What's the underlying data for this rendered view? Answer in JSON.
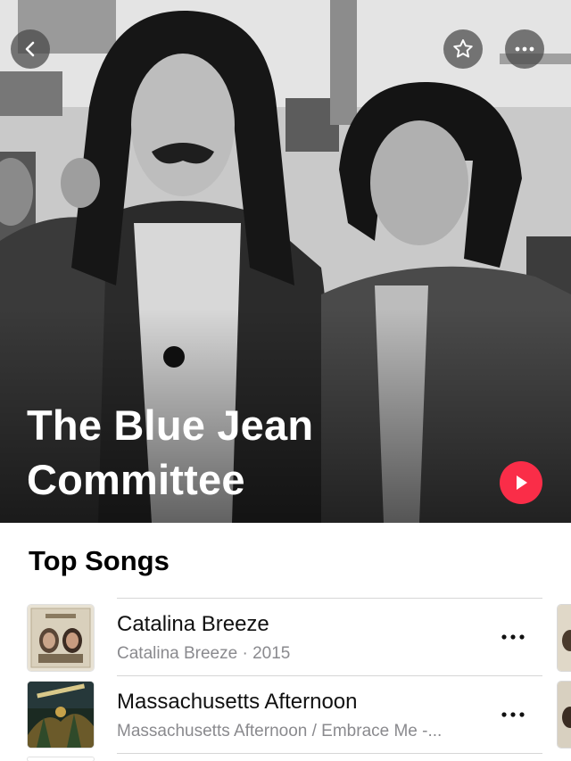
{
  "artist": {
    "name": "The Blue Jean Committee"
  },
  "section": {
    "title": "Top Songs"
  },
  "songs": [
    {
      "title": "Catalina Breeze",
      "subtitle": "Catalina Breeze · 2015"
    },
    {
      "title": "Massachusetts Afternoon",
      "subtitle": "Massachusetts Afternoon / Embrace Me -..."
    }
  ],
  "colors": {
    "accent": "#fa2d48",
    "secondary_text": "#8a8a8e"
  },
  "icons": {
    "back": "chevron-left-icon",
    "favorite": "star-icon",
    "more": "ellipsis-icon",
    "play": "play-icon"
  }
}
